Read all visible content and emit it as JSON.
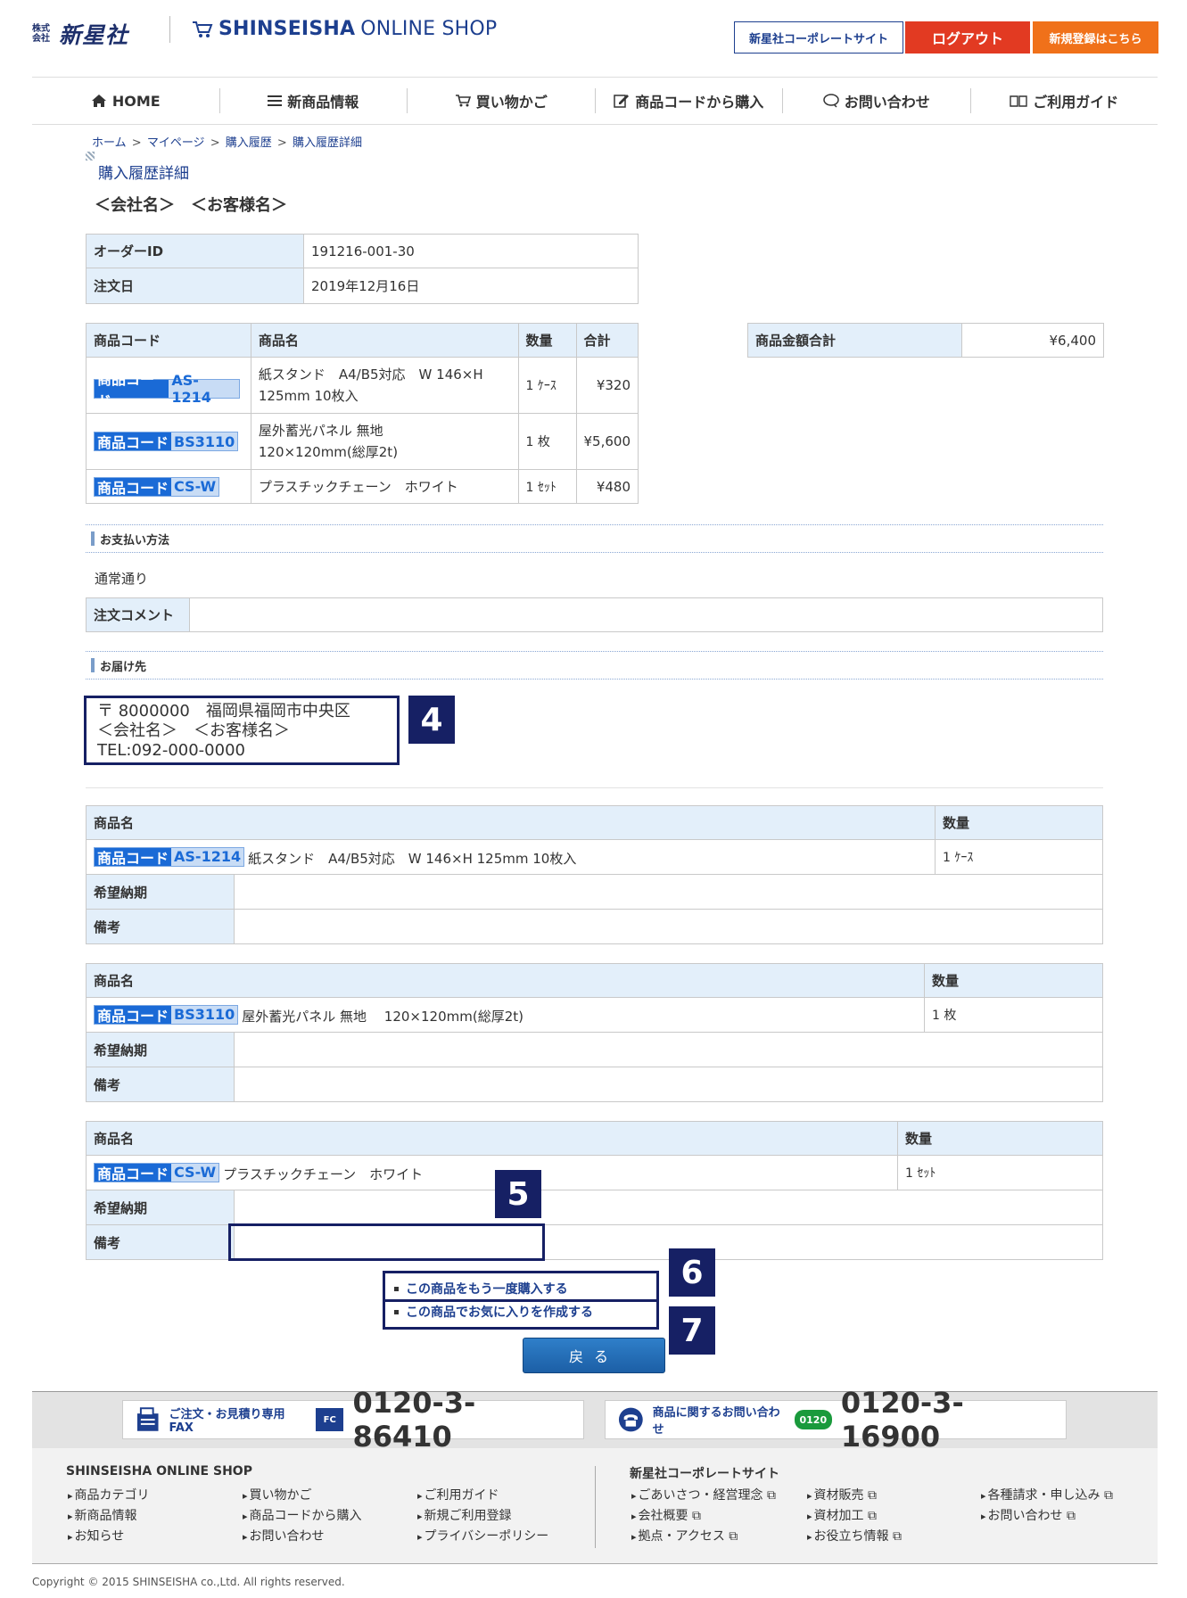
{
  "header": {
    "brand_small": "株式会社",
    "brand_big": "新星社",
    "shop_name_bold": "SHINSEISHA",
    "shop_name_thin": "ONLINE SHOP",
    "btn_corporate": "新星社コーポレートサイト",
    "btn_logout": "ログアウト",
    "btn_register": "新規登録はこちら"
  },
  "nav": [
    {
      "label": "HOME",
      "icon": "home-icon"
    },
    {
      "label": "新商品情報",
      "icon": "list-icon"
    },
    {
      "label": "買い物かご",
      "icon": "cart-icon"
    },
    {
      "label": "商品コードから購入",
      "icon": "edit-icon"
    },
    {
      "label": "お問い合わせ",
      "icon": "chat-icon"
    },
    {
      "label": "ご利用ガイド",
      "icon": "book-icon"
    }
  ],
  "breadcrumb": [
    "ホーム",
    "マイページ",
    "購入履歴",
    "購入履歴詳細"
  ],
  "page_title": "購入履歴詳細",
  "customer_name": "＜会社名＞　＜お客様名＞",
  "order": {
    "id_label": "オーダーID",
    "id_value": "191216-001-30",
    "date_label": "注文日",
    "date_value": "2019年12月16日"
  },
  "items_table": {
    "headers": [
      "商品コード",
      "商品名",
      "数量",
      "合計"
    ],
    "code_prefix": "商品コード",
    "rows": [
      {
        "code": "AS-1214",
        "name_line1": "紙スタンド　A4/B5対応　W 146×H",
        "name_line2": "125mm 10枚入",
        "qty": "1 ｹｰｽ",
        "total": "¥320"
      },
      {
        "code": "BS3110",
        "name_line1": "屋外蓄光パネル 無地",
        "name_line2": "120×120mm(総厚2t)",
        "qty": "1 枚",
        "total": "¥5,600"
      },
      {
        "code": "CS-W",
        "name_line1": "プラスチックチェーン　ホワイト",
        "name_line2": "",
        "qty": "1 ｾｯﾄ",
        "total": "¥480"
      }
    ]
  },
  "subtotal": {
    "label": "商品金額合計",
    "value": "¥6,400"
  },
  "payment": {
    "section_title": "お支払い方法",
    "value": "通常通り",
    "comment_label": "注文コメント"
  },
  "delivery": {
    "section_title": "お届け先",
    "line1": "〒 8000000　福岡県福岡市中央区",
    "line2": "＜会社名＞　＜お客様名＞",
    "line3": "TEL:092-000-0000"
  },
  "detail_blocks": [
    {
      "header_name": "商品名",
      "header_qty": "数量",
      "code": "AS-1214",
      "name": "紙スタンド　A4/B5対応　W 146×H 125mm 10枚入",
      "qty": "1 ｹｰｽ",
      "date_label": "希望納期",
      "note_label": "備考"
    },
    {
      "header_name": "商品名",
      "header_qty": "数量",
      "code": "BS3110",
      "name": "屋外蓄光パネル 無地　 120×120mm(総厚2t)",
      "qty": "1 枚",
      "date_label": "希望納期",
      "note_label": "備考"
    },
    {
      "header_name": "商品名",
      "header_qty": "数量",
      "code": "CS-W",
      "name": "プラスチックチェーン　ホワイト",
      "qty": "1 ｾｯﾄ",
      "date_label": "希望納期",
      "note_label": "備考"
    }
  ],
  "markers": [
    "4",
    "5",
    "6",
    "7"
  ],
  "actions": {
    "rebuy": "この商品をもう一度購入する",
    "favorite": "この商品でお気に入りを作成する",
    "back": "戻る"
  },
  "footer": {
    "fax_label": "ご注文・お見積り専用FAX",
    "fax_icon_text": "FC",
    "fax_number": "0120-3-86410",
    "tel_label": "商品に関するお問い合わせ",
    "tel_icon_text": "0120",
    "tel_number": "0120-3-16900",
    "shop_title": "SHINSEISHA ONLINE SHOP",
    "shop_links": [
      "商品カテゴリ",
      "買い物かご",
      "ご利用ガイド",
      "新商品情報",
      "商品コードから購入",
      "新規ご利用登録",
      "お知らせ",
      "お問い合わせ",
      "プライバシーポリシー"
    ],
    "corp_title": "新星社コーポレートサイト",
    "corp_links": [
      "ごあいさつ・経営理念",
      "資材販売",
      "各種請求・申し込み",
      "会社概要",
      "資材加工",
      "お問い合わせ",
      "拠点・アクセス",
      "お役立ち情報"
    ],
    "copyright": "Copyright © 2015 SHINSEISHA co.,Ltd. All rights reserved."
  },
  "colors": {
    "navy": "#162064",
    "brand_blue": "#1d3f8f",
    "logout_red": "#e23a22",
    "register_orange": "#f0711a",
    "label_bg": "#e3effa"
  }
}
